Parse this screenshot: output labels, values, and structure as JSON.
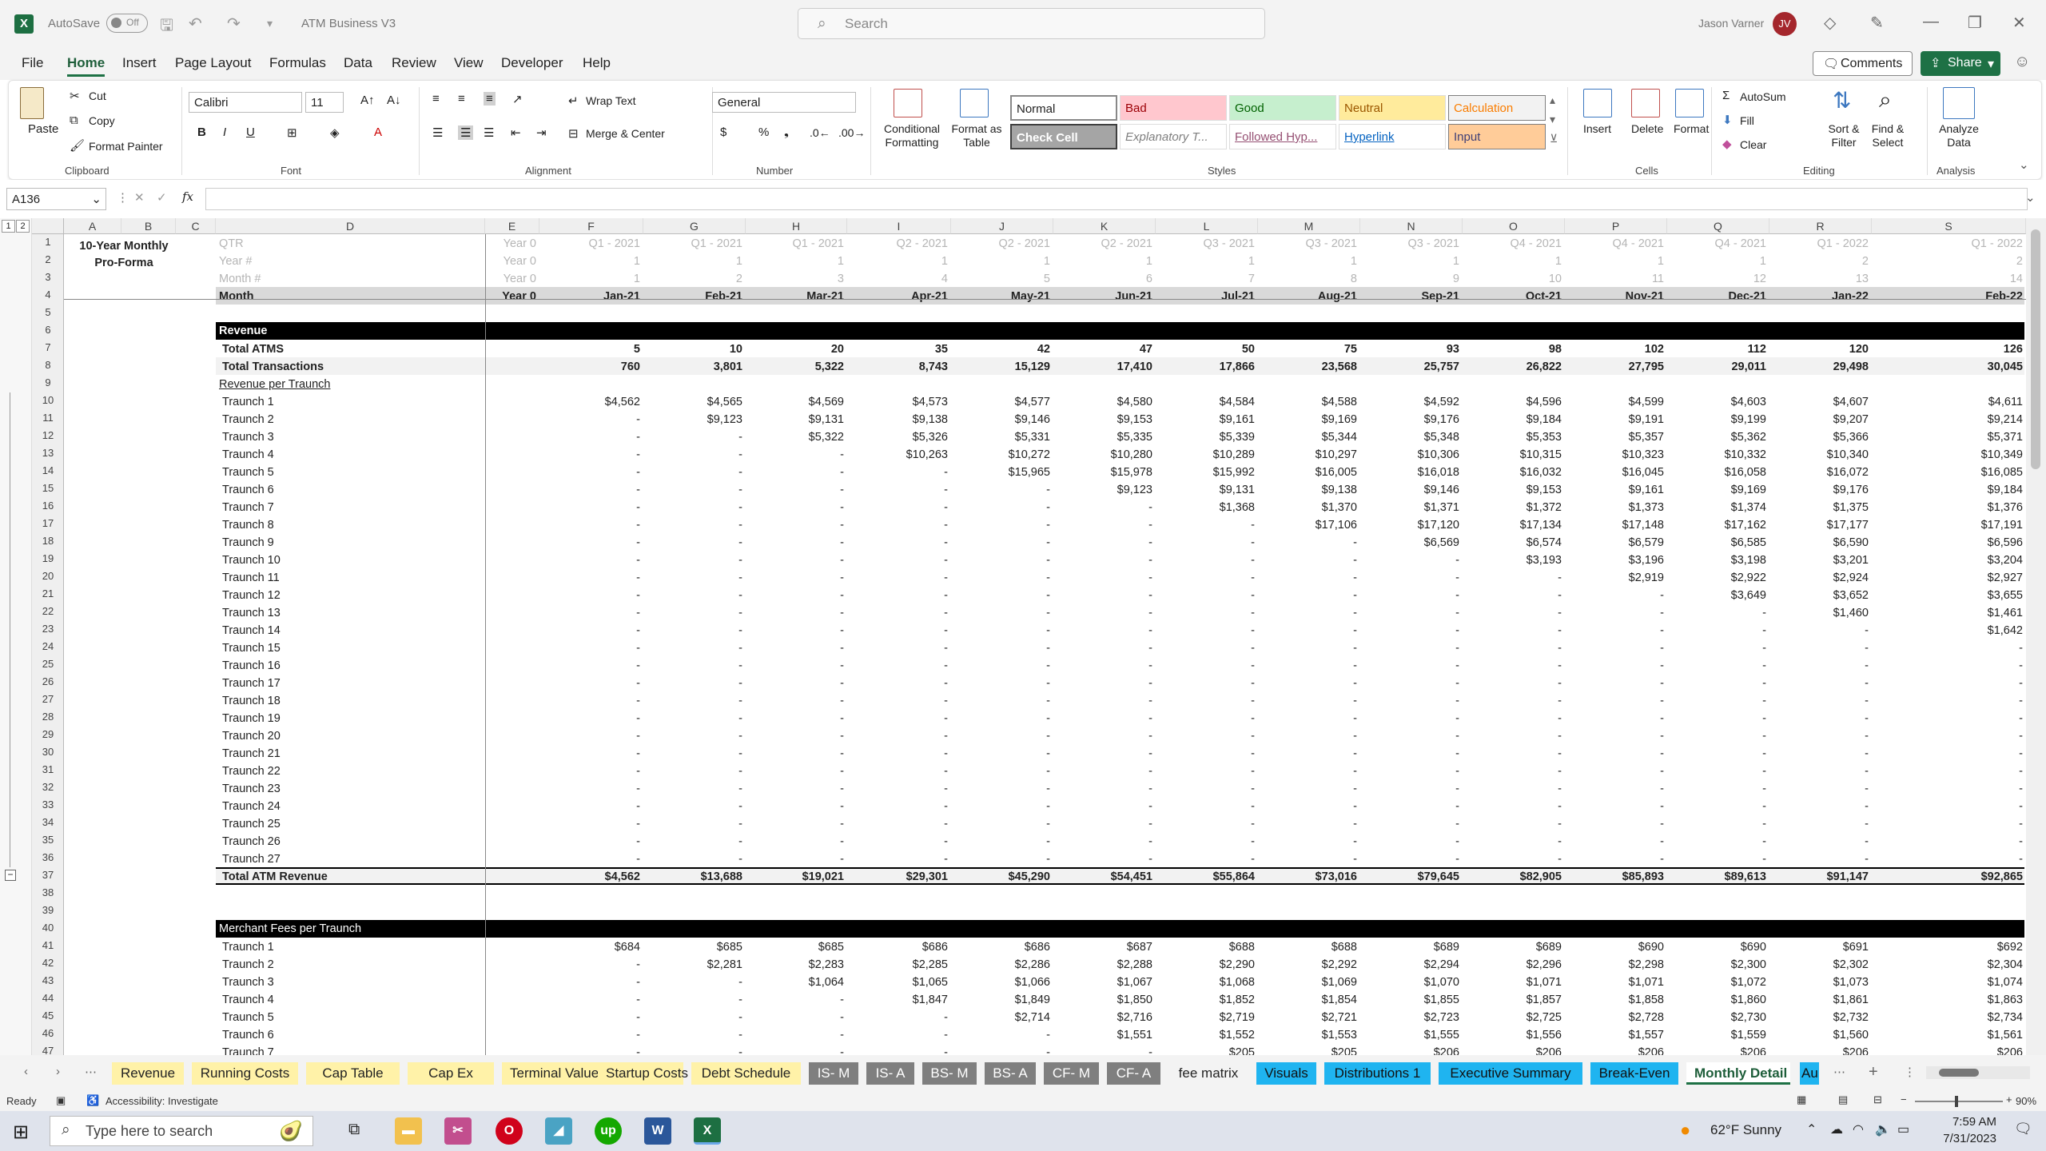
{
  "titlebar": {
    "autosave": "AutoSave",
    "toggle": "Off",
    "filename": "ATM Business V3",
    "search_placeholder": "Search",
    "user": "Jason Varner",
    "initials": "JV"
  },
  "menu": [
    "File",
    "Home",
    "Insert",
    "Page Layout",
    "Formulas",
    "Data",
    "Review",
    "View",
    "Developer",
    "Help"
  ],
  "menu_right": {
    "comments": "Comments",
    "share": "Share"
  },
  "ribbon": {
    "clipboard": {
      "paste": "Paste",
      "cut": "Cut",
      "copy": "Copy",
      "format_painter": "Format Painter",
      "label": "Clipboard"
    },
    "font": {
      "name": "Calibri",
      "size": "11",
      "label": "Font"
    },
    "alignment": {
      "wrap": "Wrap Text",
      "merge": "Merge & Center",
      "label": "Alignment"
    },
    "number": {
      "format": "General",
      "label": "Number"
    },
    "styles": {
      "cond": "Conditional Formatting",
      "fmt_table": "Format as Table",
      "normal": "Normal",
      "bad": "Bad",
      "good": "Good",
      "neutral": "Neutral",
      "calculation": "Calculation",
      "check": "Check Cell",
      "explanatory": "Explanatory T...",
      "followed": "Followed Hyp...",
      "hyperlink": "Hyperlink",
      "input": "Input",
      "label": "Styles"
    },
    "cells": {
      "insert": "Insert",
      "delete": "Delete",
      "format": "Format",
      "label": "Cells"
    },
    "editing": {
      "autosum": "AutoSum",
      "fill": "Fill",
      "clear": "Clear",
      "sort": "Sort & Filter",
      "find": "Find & Select",
      "label": "Editing"
    },
    "analysis": {
      "analyze": "Analyze Data",
      "label": "Analysis"
    }
  },
  "namebox": "A136",
  "columns": [
    "A",
    "B",
    "C",
    "D",
    "E",
    "F",
    "G",
    "H",
    "I",
    "J",
    "K",
    "L",
    "M",
    "N",
    "O",
    "P",
    "Q",
    "R",
    "S"
  ],
  "sheet": {
    "title": "10-Year Monthly Pro-Forma",
    "row_labels": {
      "qtr": "QTR",
      "year": "Year #",
      "month_num": "Month #",
      "month": "Month"
    },
    "qtr": [
      "Year 0",
      "Q1 - 2021",
      "Q1 - 2021",
      "Q1 - 2021",
      "Q2 - 2021",
      "Q2 - 2021",
      "Q2 - 2021",
      "Q3 - 2021",
      "Q3 - 2021",
      "Q3 - 2021",
      "Q4 - 2021",
      "Q4 - 2021",
      "Q4 - 2021",
      "Q1 - 2022",
      "Q1 - 2022"
    ],
    "year": [
      "Year 0",
      "1",
      "1",
      "1",
      "1",
      "1",
      "1",
      "1",
      "1",
      "1",
      "1",
      "1",
      "1",
      "2",
      "2"
    ],
    "month_num": [
      "Year 0",
      "1",
      "2",
      "3",
      "4",
      "5",
      "6",
      "7",
      "8",
      "9",
      "10",
      "11",
      "12",
      "13",
      "14"
    ],
    "month": [
      "Year 0",
      "Jan-21",
      "Feb-21",
      "Mar-21",
      "Apr-21",
      "May-21",
      "Jun-21",
      "Jul-21",
      "Aug-21",
      "Sep-21",
      "Oct-21",
      "Nov-21",
      "Dec-21",
      "Jan-22",
      "Feb-22"
    ],
    "revenue_header": "Revenue",
    "total_atms_label": "Total ATMS",
    "total_atms": [
      "5",
      "10",
      "20",
      "35",
      "42",
      "47",
      "50",
      "75",
      "93",
      "98",
      "102",
      "112",
      "120",
      "126"
    ],
    "total_tx_label": "Total Transactions",
    "total_tx": [
      "760",
      "3,801",
      "5,322",
      "8,743",
      "15,129",
      "17,410",
      "17,866",
      "23,568",
      "25,757",
      "26,822",
      "27,795",
      "29,011",
      "29,498",
      "30,045"
    ],
    "rev_per_traunch": "Revenue per Traunch",
    "traunches": [
      {
        "label": "Traunch 1",
        "v": [
          "$4,562",
          "$4,565",
          "$4,569",
          "$4,573",
          "$4,577",
          "$4,580",
          "$4,584",
          "$4,588",
          "$4,592",
          "$4,596",
          "$4,599",
          "$4,603",
          "$4,607",
          "$4,611"
        ]
      },
      {
        "label": "Traunch 2",
        "v": [
          "-",
          "$9,123",
          "$9,131",
          "$9,138",
          "$9,146",
          "$9,153",
          "$9,161",
          "$9,169",
          "$9,176",
          "$9,184",
          "$9,191",
          "$9,199",
          "$9,207",
          "$9,214"
        ]
      },
      {
        "label": "Traunch 3",
        "v": [
          "-",
          "-",
          "$5,322",
          "$5,326",
          "$5,331",
          "$5,335",
          "$5,339",
          "$5,344",
          "$5,348",
          "$5,353",
          "$5,357",
          "$5,362",
          "$5,366",
          "$5,371"
        ]
      },
      {
        "label": "Traunch 4",
        "v": [
          "-",
          "-",
          "-",
          "$10,263",
          "$10,272",
          "$10,280",
          "$10,289",
          "$10,297",
          "$10,306",
          "$10,315",
          "$10,323",
          "$10,332",
          "$10,340",
          "$10,349"
        ]
      },
      {
        "label": "Traunch 5",
        "v": [
          "-",
          "-",
          "-",
          "-",
          "$15,965",
          "$15,978",
          "$15,992",
          "$16,005",
          "$16,018",
          "$16,032",
          "$16,045",
          "$16,058",
          "$16,072",
          "$16,085"
        ]
      },
      {
        "label": "Traunch 6",
        "v": [
          "-",
          "-",
          "-",
          "-",
          "-",
          "$9,123",
          "$9,131",
          "$9,138",
          "$9,146",
          "$9,153",
          "$9,161",
          "$9,169",
          "$9,176",
          "$9,184"
        ]
      },
      {
        "label": "Traunch 7",
        "v": [
          "-",
          "-",
          "-",
          "-",
          "-",
          "-",
          "$1,368",
          "$1,370",
          "$1,371",
          "$1,372",
          "$1,373",
          "$1,374",
          "$1,375",
          "$1,376"
        ]
      },
      {
        "label": "Traunch 8",
        "v": [
          "-",
          "-",
          "-",
          "-",
          "-",
          "-",
          "-",
          "$17,106",
          "$17,120",
          "$17,134",
          "$17,148",
          "$17,162",
          "$17,177",
          "$17,191"
        ]
      },
      {
        "label": "Traunch 9",
        "v": [
          "-",
          "-",
          "-",
          "-",
          "-",
          "-",
          "-",
          "-",
          "$6,569",
          "$6,574",
          "$6,579",
          "$6,585",
          "$6,590",
          "$6,596"
        ]
      },
      {
        "label": "Traunch 10",
        "v": [
          "-",
          "-",
          "-",
          "-",
          "-",
          "-",
          "-",
          "-",
          "-",
          "$3,193",
          "$3,196",
          "$3,198",
          "$3,201",
          "$3,204"
        ]
      },
      {
        "label": "Traunch 11",
        "v": [
          "-",
          "-",
          "-",
          "-",
          "-",
          "-",
          "-",
          "-",
          "-",
          "-",
          "$2,919",
          "$2,922",
          "$2,924",
          "$2,927"
        ]
      },
      {
        "label": "Traunch 12",
        "v": [
          "-",
          "-",
          "-",
          "-",
          "-",
          "-",
          "-",
          "-",
          "-",
          "-",
          "-",
          "$3,649",
          "$3,652",
          "$3,655"
        ]
      },
      {
        "label": "Traunch 13",
        "v": [
          "-",
          "-",
          "-",
          "-",
          "-",
          "-",
          "-",
          "-",
          "-",
          "-",
          "-",
          "-",
          "$1,460",
          "$1,461"
        ]
      },
      {
        "label": "Traunch 14",
        "v": [
          "-",
          "-",
          "-",
          "-",
          "-",
          "-",
          "-",
          "-",
          "-",
          "-",
          "-",
          "-",
          "-",
          "$1,642"
        ]
      },
      {
        "label": "Traunch 15",
        "v": [
          "-",
          "-",
          "-",
          "-",
          "-",
          "-",
          "-",
          "-",
          "-",
          "-",
          "-",
          "-",
          "-",
          "-"
        ]
      },
      {
        "label": "Traunch 16",
        "v": [
          "-",
          "-",
          "-",
          "-",
          "-",
          "-",
          "-",
          "-",
          "-",
          "-",
          "-",
          "-",
          "-",
          "-"
        ]
      },
      {
        "label": "Traunch 17",
        "v": [
          "-",
          "-",
          "-",
          "-",
          "-",
          "-",
          "-",
          "-",
          "-",
          "-",
          "-",
          "-",
          "-",
          "-"
        ]
      },
      {
        "label": "Traunch 18",
        "v": [
          "-",
          "-",
          "-",
          "-",
          "-",
          "-",
          "-",
          "-",
          "-",
          "-",
          "-",
          "-",
          "-",
          "-"
        ]
      },
      {
        "label": "Traunch 19",
        "v": [
          "-",
          "-",
          "-",
          "-",
          "-",
          "-",
          "-",
          "-",
          "-",
          "-",
          "-",
          "-",
          "-",
          "-"
        ]
      },
      {
        "label": "Traunch 20",
        "v": [
          "-",
          "-",
          "-",
          "-",
          "-",
          "-",
          "-",
          "-",
          "-",
          "-",
          "-",
          "-",
          "-",
          "-"
        ]
      },
      {
        "label": "Traunch 21",
        "v": [
          "-",
          "-",
          "-",
          "-",
          "-",
          "-",
          "-",
          "-",
          "-",
          "-",
          "-",
          "-",
          "-",
          "-"
        ]
      },
      {
        "label": "Traunch 22",
        "v": [
          "-",
          "-",
          "-",
          "-",
          "-",
          "-",
          "-",
          "-",
          "-",
          "-",
          "-",
          "-",
          "-",
          "-"
        ]
      },
      {
        "label": "Traunch 23",
        "v": [
          "-",
          "-",
          "-",
          "-",
          "-",
          "-",
          "-",
          "-",
          "-",
          "-",
          "-",
          "-",
          "-",
          "-"
        ]
      },
      {
        "label": "Traunch 24",
        "v": [
          "-",
          "-",
          "-",
          "-",
          "-",
          "-",
          "-",
          "-",
          "-",
          "-",
          "-",
          "-",
          "-",
          "-"
        ]
      },
      {
        "label": "Traunch 25",
        "v": [
          "-",
          "-",
          "-",
          "-",
          "-",
          "-",
          "-",
          "-",
          "-",
          "-",
          "-",
          "-",
          "-",
          "-"
        ]
      },
      {
        "label": "Traunch 26",
        "v": [
          "-",
          "-",
          "-",
          "-",
          "-",
          "-",
          "-",
          "-",
          "-",
          "-",
          "-",
          "-",
          "-",
          "-"
        ]
      },
      {
        "label": "Traunch 27",
        "v": [
          "-",
          "-",
          "-",
          "-",
          "-",
          "-",
          "-",
          "-",
          "-",
          "-",
          "-",
          "-",
          "-",
          "-"
        ]
      }
    ],
    "total_rev_label": "Total ATM Revenue",
    "total_rev": [
      "$4,562",
      "$13,688",
      "$19,021",
      "$29,301",
      "$45,290",
      "$54,451",
      "$55,864",
      "$73,016",
      "$79,645",
      "$82,905",
      "$85,893",
      "$89,613",
      "$91,147",
      "$92,865"
    ],
    "fees_header": "Merchant Fees per Traunch",
    "fees": [
      {
        "label": "Traunch 1",
        "v": [
          "$684",
          "$685",
          "$685",
          "$686",
          "$686",
          "$687",
          "$688",
          "$688",
          "$689",
          "$689",
          "$690",
          "$690",
          "$691",
          "$692"
        ]
      },
      {
        "label": "Traunch 2",
        "v": [
          "-",
          "$2,281",
          "$2,283",
          "$2,285",
          "$2,286",
          "$2,288",
          "$2,290",
          "$2,292",
          "$2,294",
          "$2,296",
          "$2,298",
          "$2,300",
          "$2,302",
          "$2,304"
        ]
      },
      {
        "label": "Traunch 3",
        "v": [
          "-",
          "-",
          "$1,064",
          "$1,065",
          "$1,066",
          "$1,067",
          "$1,068",
          "$1,069",
          "$1,070",
          "$1,071",
          "$1,071",
          "$1,072",
          "$1,073",
          "$1,074"
        ]
      },
      {
        "label": "Traunch 4",
        "v": [
          "-",
          "-",
          "-",
          "$1,847",
          "$1,849",
          "$1,850",
          "$1,852",
          "$1,854",
          "$1,855",
          "$1,857",
          "$1,858",
          "$1,860",
          "$1,861",
          "$1,863"
        ]
      },
      {
        "label": "Traunch 5",
        "v": [
          "-",
          "-",
          "-",
          "-",
          "$2,714",
          "$2,716",
          "$2,719",
          "$2,721",
          "$2,723",
          "$2,725",
          "$2,728",
          "$2,730",
          "$2,732",
          "$2,734"
        ]
      },
      {
        "label": "Traunch 6",
        "v": [
          "-",
          "-",
          "-",
          "-",
          "-",
          "$1,551",
          "$1,552",
          "$1,553",
          "$1,555",
          "$1,556",
          "$1,557",
          "$1,559",
          "$1,560",
          "$1,561"
        ]
      },
      {
        "label": "Traunch 7",
        "v": [
          "-",
          "-",
          "-",
          "-",
          "-",
          "-",
          "$205",
          "$205",
          "$206",
          "$206",
          "$206",
          "$206",
          "$206",
          "$206"
        ]
      }
    ]
  },
  "tabs": [
    "Revenue",
    "Running Costs",
    "Cap Table",
    "Cap Ex",
    "Terminal Value",
    "Startup Costs",
    "Debt Schedule",
    "IS- M",
    "IS- A",
    "BS- M",
    "BS- A",
    "CF- M",
    "CF- A",
    "fee matrix",
    "Visuals",
    "Distributions 1",
    "Executive Summary",
    "Break-Even",
    "Monthly Detail",
    "Au"
  ],
  "status": {
    "ready": "Ready",
    "accessibility": "Accessibility: Investigate",
    "zoom": "90%"
  },
  "taskbar": {
    "search": "Type here to search",
    "weather": "62°F  Sunny",
    "time": "7:59 AM",
    "date": "7/31/2023"
  },
  "colors": {
    "excel_green": "#1e7145",
    "tab_yellow": "#fff2a8",
    "tab_gray": "#7f7f7f",
    "tab_blue": "#1fb4f0",
    "bad_fill": "#ffc7ce",
    "good_fill": "#c6efce",
    "neutral_fill": "#ffeb9c",
    "calc_fill": "#f2f2f2",
    "input_fill": "#ffcc99"
  }
}
